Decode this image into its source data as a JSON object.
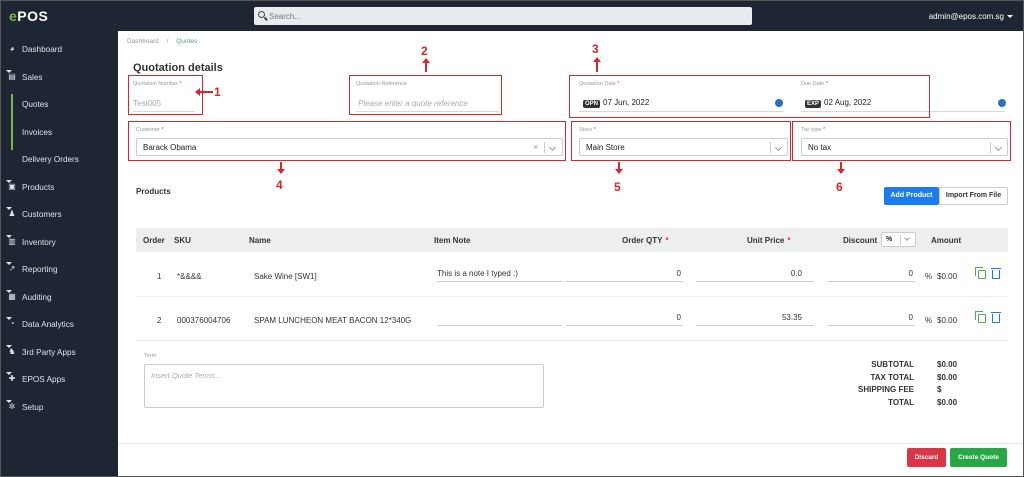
{
  "brand": {
    "logo_e": "e",
    "logo_rest": "POS"
  },
  "search": {
    "placeholder": "Search..."
  },
  "user": {
    "email": "admin@epos.com.sg"
  },
  "sidebar": {
    "items": [
      {
        "label": "Dashboard",
        "icon": "dashboard-icon",
        "glyph": "◕",
        "caret": false
      },
      {
        "label": "Sales",
        "icon": "cart-icon",
        "glyph": "▤",
        "caret": true
      },
      {
        "label": "Quotes",
        "icon": "",
        "glyph": "",
        "caret": false,
        "sub": true,
        "active": true
      },
      {
        "label": "Invoices",
        "icon": "",
        "glyph": "",
        "caret": false,
        "sub": true
      },
      {
        "label": "Delivery Orders",
        "icon": "",
        "glyph": "",
        "caret": false,
        "sub": true
      },
      {
        "label": "Products",
        "icon": "box-icon",
        "glyph": "▣",
        "caret": true
      },
      {
        "label": "Customers",
        "icon": "users-icon",
        "glyph": "♟",
        "caret": true
      },
      {
        "label": "Inventory",
        "icon": "inventory-icon",
        "glyph": "▥",
        "caret": true
      },
      {
        "label": "Reporting",
        "icon": "chart-icon",
        "glyph": "↗",
        "caret": true
      },
      {
        "label": "Auditing",
        "icon": "audit-icon",
        "glyph": "▦",
        "caret": true
      },
      {
        "label": "Data Analytics",
        "icon": "analytics-icon",
        "glyph": "◔",
        "caret": true
      },
      {
        "label": "3rd Party Apps",
        "icon": "apps-icon",
        "glyph": "♞",
        "caret": true
      },
      {
        "label": "EPOS Apps",
        "icon": "plus-icon",
        "glyph": "✚",
        "caret": true
      },
      {
        "label": "Setup",
        "icon": "gear-icon",
        "glyph": "✲",
        "caret": true
      }
    ]
  },
  "breadcrumb": {
    "home": "Dashboard",
    "sep": "/",
    "current": "Quotes"
  },
  "page": {
    "title": "Quotation details"
  },
  "fields": {
    "quotation_number": {
      "label": "Quotation Number",
      "value": "Test005"
    },
    "quotation_reference": {
      "label": "Quotation Reference",
      "placeholder": "Please enter a quote reference"
    },
    "quotation_date": {
      "label": "Quotation Date",
      "tag": "OPN",
      "value": "07 Jun, 2022"
    },
    "due_date": {
      "label": "Due Date",
      "tag": "EXP",
      "value": "02 Aug, 2022"
    },
    "customer": {
      "label": "Customer",
      "value": "Barack Obama"
    },
    "store": {
      "label": "Store",
      "value": "Main Store"
    },
    "tax_type": {
      "label": "Tax type",
      "value": "No tax"
    }
  },
  "annotations": [
    "1",
    "2",
    "3",
    "4",
    "5",
    "6"
  ],
  "products": {
    "heading": "Products",
    "add_button": "Add Product",
    "import_button": "Import From File",
    "columns": {
      "order": "Order",
      "sku": "SKU",
      "name": "Name",
      "item_note": "Item Note",
      "order_qty": "Order QTY",
      "unit_price": "Unit Price",
      "discount": "Discount",
      "discount_type": "%",
      "amount": "Amount",
      "required": "*"
    },
    "rows": [
      {
        "order": "1",
        "sku": "*&&&&",
        "name": "Sake Wine [SW1]",
        "note": "This is a note I typed :)",
        "qty": "0",
        "price": "0.0",
        "discount": "0",
        "pct": "%",
        "amount": "$0.00"
      },
      {
        "order": "2",
        "sku": "000376004706",
        "name": "SPAM LUNCHEON MEAT BACON 12*340G",
        "note": "",
        "qty": "0",
        "price": "53.35",
        "discount": "0",
        "pct": "%",
        "amount": "$0.00"
      }
    ]
  },
  "terms": {
    "label": "Term",
    "placeholder": "Insert Quote Terms..."
  },
  "totals": [
    {
      "label": "SUBTOTAL",
      "value": "$0.00"
    },
    {
      "label": "TAX TOTAL",
      "value": "$0.00"
    },
    {
      "label": "SHIPPING FEE",
      "value": "$"
    },
    {
      "label": "TOTAL",
      "value": "$0.00"
    }
  ],
  "actions": {
    "discard": "Discard",
    "create": "Create Quote"
  },
  "colors": {
    "sidebar": "#1f2633",
    "accent_green": "#7ab648",
    "primary": "#1a7cf0",
    "danger": "#dc3545",
    "success": "#28a745",
    "annotation_red": "#d9262c"
  }
}
